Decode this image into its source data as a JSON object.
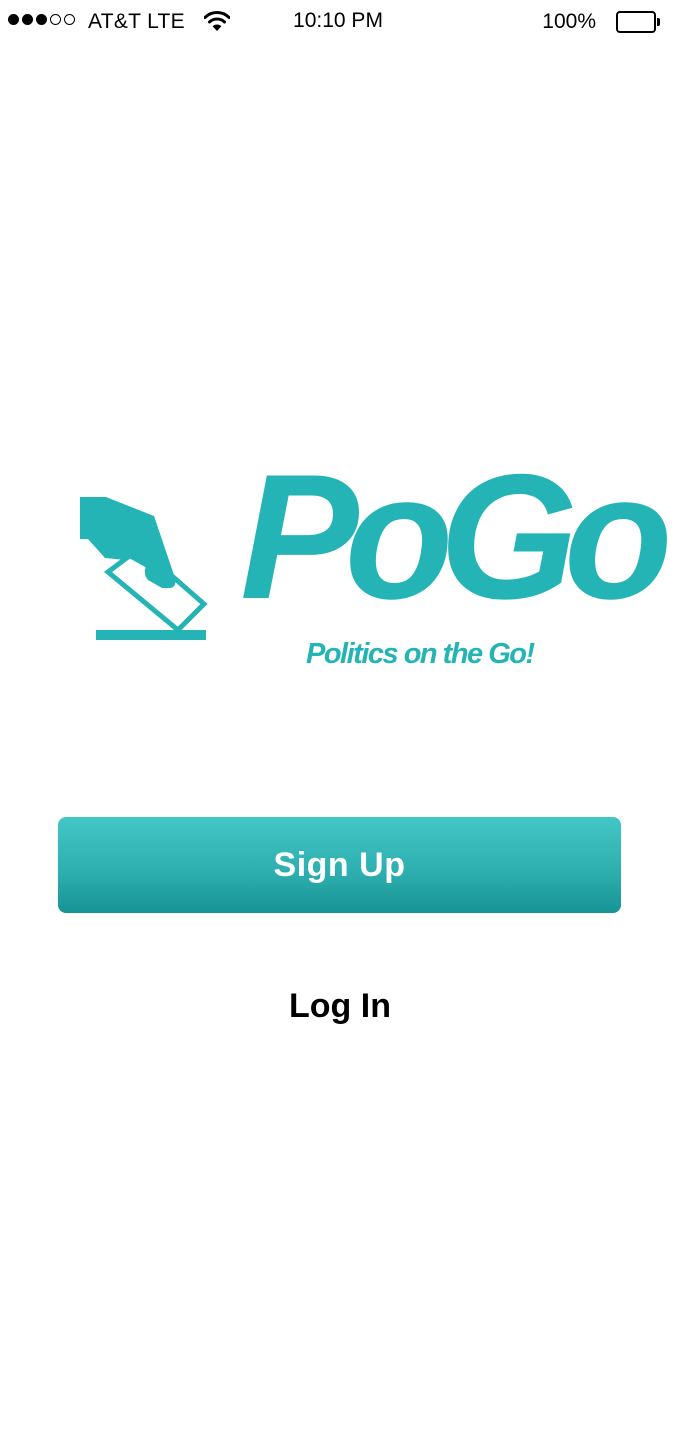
{
  "status_bar": {
    "signal_bars_filled": 3,
    "signal_bars_total": 5,
    "carrier": "AT&T LTE",
    "time": "10:10 PM",
    "battery_percent": "100%",
    "battery_level": 1.0
  },
  "logo": {
    "wordmark": "PoGo",
    "tagline": "Politics on the Go!",
    "icon": "ballot-box-icon",
    "color": "#24b4b6"
  },
  "actions": {
    "signup_label": "Sign Up",
    "login_label": "Log In"
  },
  "colors": {
    "accent": "#24b4b6",
    "button_top": "#44c6c6",
    "button_bottom": "#179394"
  }
}
